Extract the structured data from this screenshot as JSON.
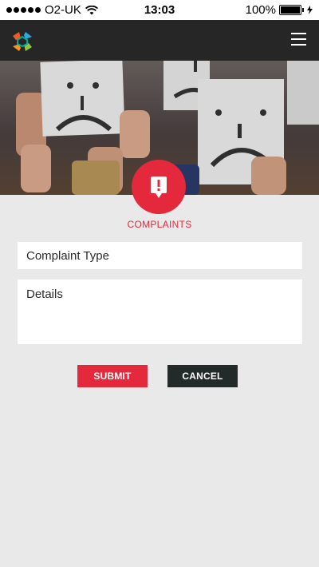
{
  "status_bar": {
    "carrier": "O2-UK",
    "time": "13:03",
    "battery": "100%"
  },
  "nav": {
    "logo_icon": "pinwheel-logo",
    "menu_icon": "hamburger-icon"
  },
  "hero": {
    "image": "people-holding-sad-face-signs"
  },
  "badge": {
    "icon": "exclamation-speech-bubble-icon",
    "label": "COMPLAINTS",
    "color": "#e3293b"
  },
  "form": {
    "complaint_type_placeholder": "Complaint Type",
    "details_placeholder": "Details"
  },
  "buttons": {
    "submit_label": "SUBMIT",
    "cancel_label": "CANCEL",
    "submit_color": "#e3293b",
    "cancel_color": "#232a2a"
  }
}
